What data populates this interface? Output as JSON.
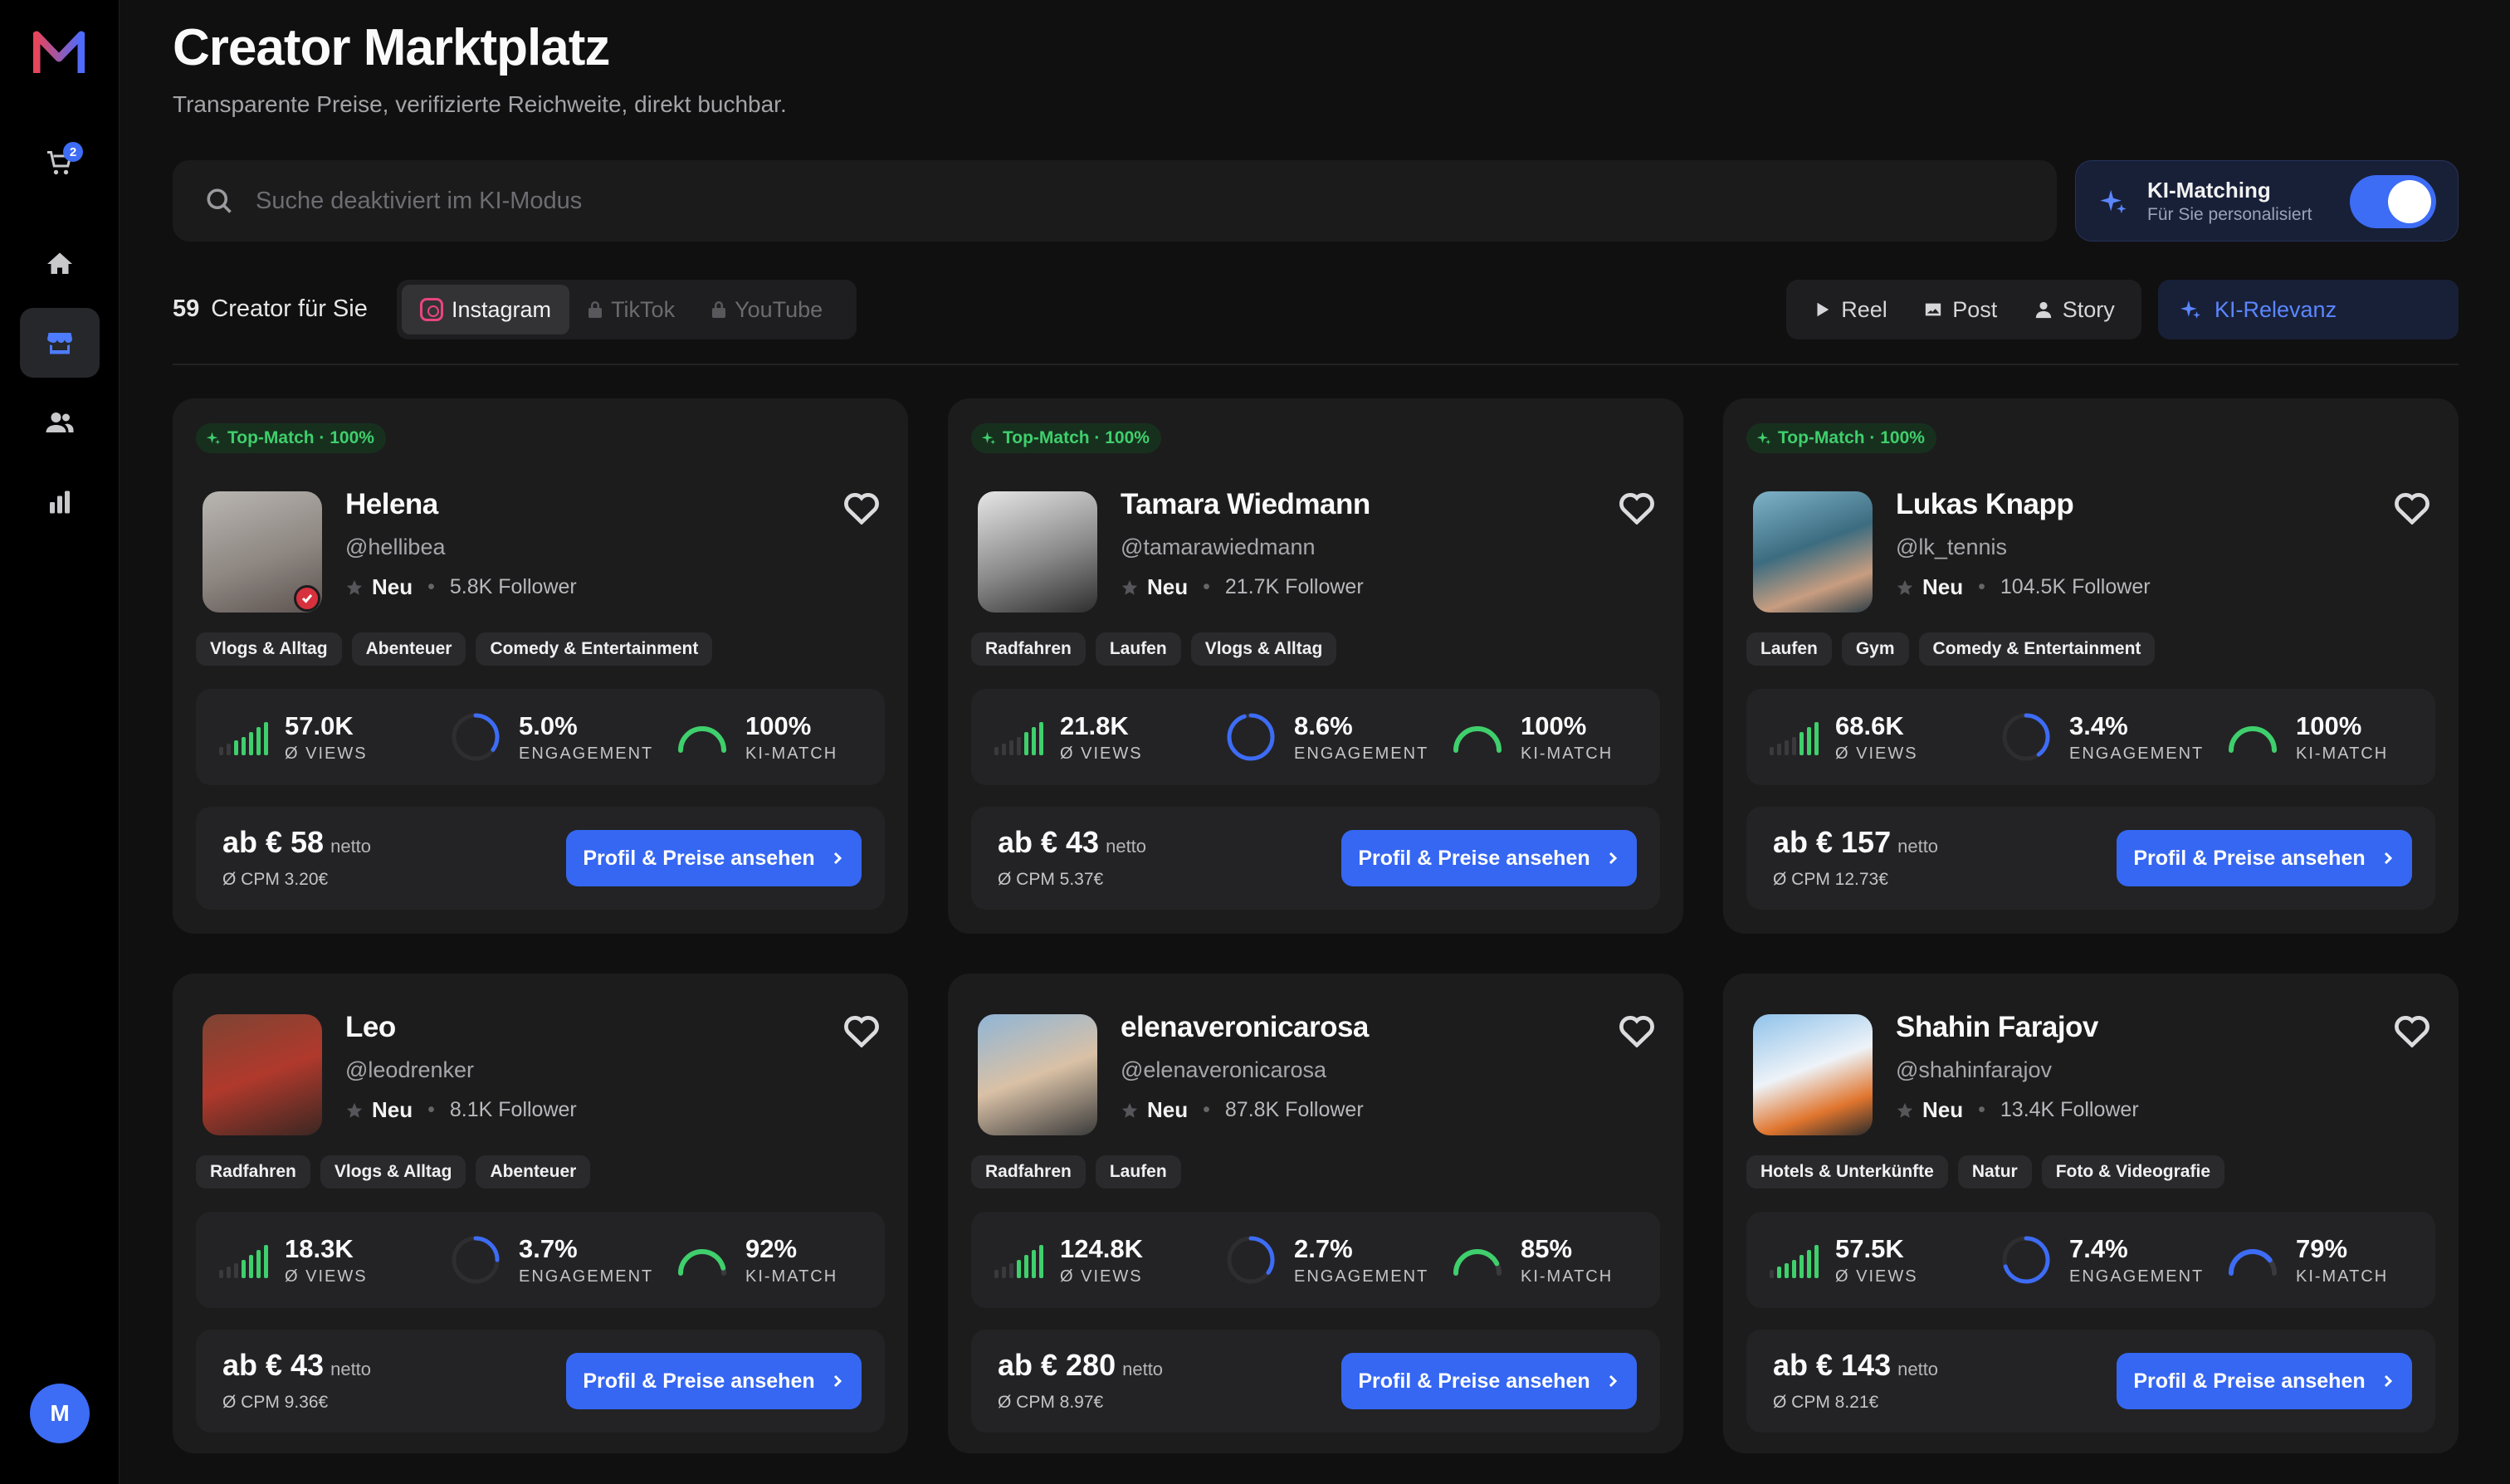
{
  "colors": {
    "accent": "#3d6cf5",
    "positive": "#3fcf6c",
    "verified": "#d6313d"
  },
  "sidebar": {
    "cart_count": "2",
    "avatar_initial": "M",
    "items": [
      {
        "icon": "cart-icon"
      },
      {
        "icon": "home-icon"
      },
      {
        "icon": "store-icon",
        "active": true
      },
      {
        "icon": "users-icon"
      },
      {
        "icon": "bar-chart-icon"
      }
    ]
  },
  "header": {
    "title": "Creator Marktplatz",
    "subtitle": "Transparente Preise, verifizierte Reichweite, direkt buchbar."
  },
  "search": {
    "placeholder": "Suche deaktiviert im KI-Modus",
    "value": ""
  },
  "ki_matching": {
    "title": "KI-Matching",
    "subtitle": "Für Sie personalisiert",
    "enabled": true
  },
  "results": {
    "count": "59",
    "label": "Creator für Sie"
  },
  "platforms": [
    {
      "label": "Instagram",
      "active": true
    },
    {
      "label": "TikTok",
      "locked": true
    },
    {
      "label": "YouTube",
      "locked": true
    }
  ],
  "formats": [
    {
      "label": "Reel",
      "icon": "play-icon"
    },
    {
      "label": "Post",
      "icon": "image-icon"
    },
    {
      "label": "Story",
      "icon": "person-icon"
    }
  ],
  "sort": {
    "label": "KI-Relevanz"
  },
  "card_labels": {
    "badge": "Top-Match · 100%",
    "status": "Neu",
    "views": "Ø VIEWS",
    "engagement": "ENGAGEMENT",
    "match": "KI-MATCH",
    "netto": "netto",
    "cta": "Profil & Preise ansehen"
  },
  "creators": [
    {
      "name": "Helena",
      "handle": "@hellibea",
      "followers": "5.8K Follower",
      "verified": true,
      "tags": [
        "Vlogs & Alltag",
        "Abenteuer",
        "Comedy & Entertainment"
      ],
      "views": "57.0K",
      "views_level": 0.7,
      "engagement": "5.0%",
      "engagement_fraction": 0.35,
      "match": "100%",
      "match_fraction": 1.0,
      "price": "ab € 58",
      "cpm": "Ø CPM 3.20€"
    },
    {
      "name": "Tamara Wiedmann",
      "handle": "@tamarawiedmann",
      "followers": "21.7K Follower",
      "verified": false,
      "tags": [
        "Radfahren",
        "Laufen",
        "Vlogs & Alltag"
      ],
      "views": "21.8K",
      "views_level": 0.4,
      "engagement": "8.6%",
      "engagement_fraction": 0.95,
      "match": "100%",
      "match_fraction": 1.0,
      "price": "ab € 43",
      "cpm": "Ø CPM 5.37€"
    },
    {
      "name": "Lukas Knapp",
      "handle": "@lk_tennis",
      "followers": "104.5K Follower",
      "verified": false,
      "tags": [
        "Laufen",
        "Gym",
        "Comedy & Entertainment"
      ],
      "views": "68.6K",
      "views_level": 0.4,
      "engagement": "3.4%",
      "engagement_fraction": 0.4,
      "match": "100%",
      "match_fraction": 1.0,
      "price": "ab € 157",
      "cpm": "Ø CPM 12.73€"
    },
    {
      "name": "Leo",
      "handle": "@leodrenker",
      "followers": "8.1K Follower",
      "verified": false,
      "tags": [
        "Radfahren",
        "Vlogs & Alltag",
        "Abenteuer"
      ],
      "views": "18.3K",
      "views_level": 0.6,
      "engagement": "3.7%",
      "engagement_fraction": 0.25,
      "match": "92%",
      "match_fraction": 0.92,
      "price": "ab € 43",
      "cpm": "Ø CPM 9.36€"
    },
    {
      "name": "elenaveronicarosa",
      "handle": "@elenaveronicarosa",
      "followers": "87.8K Follower",
      "verified": false,
      "tags": [
        "Radfahren",
        "Laufen"
      ],
      "views": "124.8K",
      "views_level": 0.6,
      "engagement": "2.7%",
      "engagement_fraction": 0.35,
      "match": "85%",
      "match_fraction": 0.85,
      "price": "ab € 280",
      "cpm": "Ø CPM 8.97€"
    },
    {
      "name": "Shahin Farajov",
      "handle": "@shahinfarajov",
      "followers": "13.4K Follower",
      "verified": false,
      "tags": [
        "Hotels & Unterkünfte",
        "Natur",
        "Foto & Videografie"
      ],
      "views": "57.5K",
      "views_level": 0.8,
      "engagement": "7.4%",
      "engagement_fraction": 0.7,
      "match": "79%",
      "match_fraction": 0.79,
      "price": "ab € 143",
      "cpm": "Ø CPM 8.21€"
    }
  ]
}
